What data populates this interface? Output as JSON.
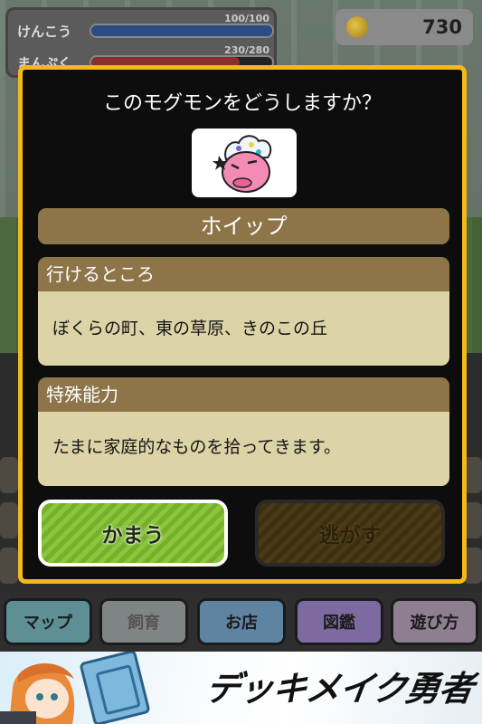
{
  "status": {
    "health": {
      "label": "けんこう",
      "value": "100/100",
      "fraction": 1.0
    },
    "fullness": {
      "label": "まんぷく",
      "value": "230/280",
      "fraction": 0.82
    }
  },
  "coins": {
    "icon": "coin-icon",
    "amount": "730"
  },
  "dialog": {
    "title": "このモグモンをどうしますか？",
    "monster_name": "ホイップ",
    "places": {
      "header": "行けるところ",
      "text": "ぼくらの町、東の草原、きのこの丘"
    },
    "ability": {
      "header": "特殊能力",
      "text": "たまに家庭的なものを拾ってきます。"
    },
    "keep_label": "かまう",
    "release_label": "逃がす"
  },
  "nav": {
    "map": "マップ",
    "breed": "飼育",
    "shop": "お店",
    "book": "図鑑",
    "help": "遊び方"
  },
  "banner": {
    "logo_text": "デッキメイク勇者"
  },
  "colors": {
    "dialog_border": "#f3b91a",
    "header_brown": "#8e7449",
    "body_cream": "#dcd3a7",
    "keep_green": "#8cc63f"
  }
}
